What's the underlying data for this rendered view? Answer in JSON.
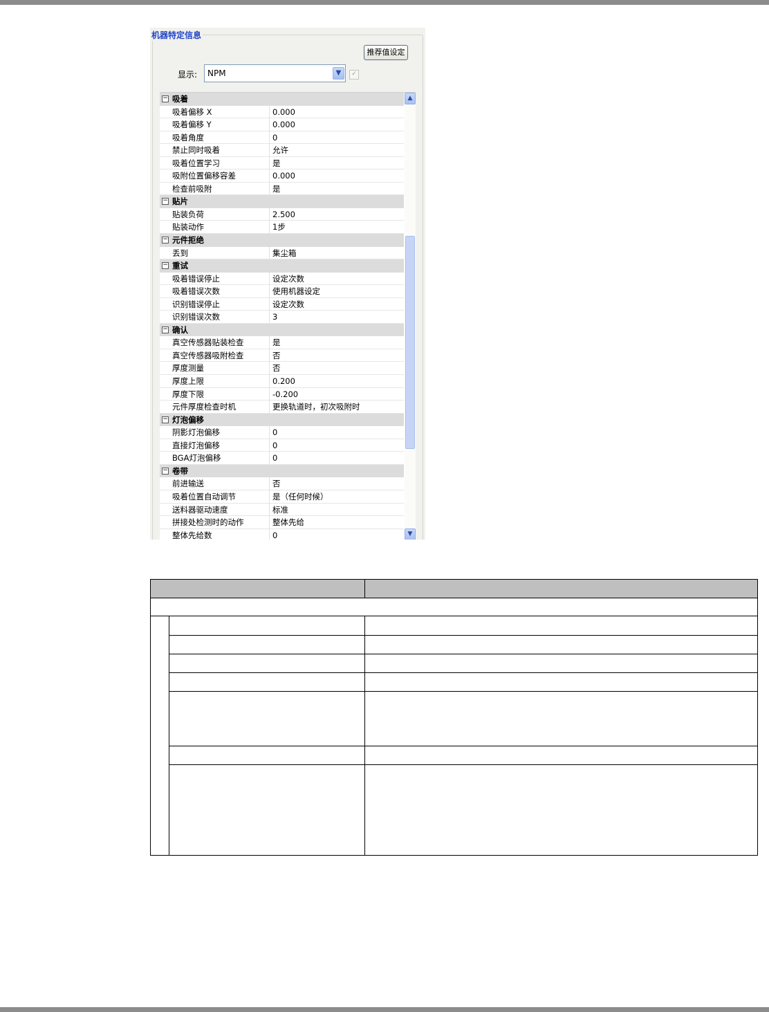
{
  "panel": {
    "group_title": "机器特定信息",
    "recommend_button": "推荐值设定",
    "display_label": "显示:",
    "display_value": "NPM",
    "checkbox_glyph": "✓"
  },
  "grid": {
    "rows": [
      {
        "type": "cat",
        "label": "吸着"
      },
      {
        "type": "prop",
        "name": "吸着偏移 X",
        "value": "0.000"
      },
      {
        "type": "prop",
        "name": "吸着偏移 Y",
        "value": "0.000"
      },
      {
        "type": "prop",
        "name": "吸着角度",
        "value": "0"
      },
      {
        "type": "prop",
        "name": "禁止同时吸着",
        "value": "允许"
      },
      {
        "type": "prop",
        "name": "吸着位置学习",
        "value": "是"
      },
      {
        "type": "prop",
        "name": "吸附位置偏移容差",
        "value": "0.000"
      },
      {
        "type": "prop",
        "name": "检查前吸附",
        "value": "是"
      },
      {
        "type": "cat",
        "label": "贴片"
      },
      {
        "type": "prop",
        "name": "贴装负荷",
        "value": "2.500"
      },
      {
        "type": "prop",
        "name": "贴装动作",
        "value": "1步"
      },
      {
        "type": "cat",
        "label": "元件拒绝"
      },
      {
        "type": "prop",
        "name": "丢到",
        "value": "集尘箱"
      },
      {
        "type": "cat",
        "label": "重试"
      },
      {
        "type": "prop",
        "name": "吸着错误停止",
        "value": "设定次数"
      },
      {
        "type": "prop",
        "name": "吸着错误次数",
        "value": "使用机器设定"
      },
      {
        "type": "prop",
        "name": "识别错误停止",
        "value": "设定次数"
      },
      {
        "type": "prop",
        "name": "识别错误次数",
        "value": "3"
      },
      {
        "type": "cat",
        "label": "确认"
      },
      {
        "type": "prop",
        "name": "真空传感器贴装检查",
        "value": "是"
      },
      {
        "type": "prop",
        "name": "真空传感器吸附检查",
        "value": "否"
      },
      {
        "type": "prop",
        "name": "厚度测量",
        "value": "否"
      },
      {
        "type": "prop",
        "name": "厚度上限",
        "value": "0.200"
      },
      {
        "type": "prop",
        "name": "厚度下限",
        "value": "-0.200"
      },
      {
        "type": "prop",
        "name": "元件厚度检查时机",
        "value": "更换轨道时，初次吸附时"
      },
      {
        "type": "cat",
        "label": "灯泡偏移"
      },
      {
        "type": "prop",
        "name": "阴影灯泡偏移",
        "value": "0"
      },
      {
        "type": "prop",
        "name": "直接灯泡偏移",
        "value": "0"
      },
      {
        "type": "prop",
        "name": "BGA灯泡偏移",
        "value": "0"
      },
      {
        "type": "cat",
        "label": "卷带"
      },
      {
        "type": "prop",
        "name": "前进输送",
        "value": "否"
      },
      {
        "type": "prop",
        "name": "吸着位置自动调节",
        "value": "是（任何时候）"
      },
      {
        "type": "prop",
        "name": "送料器驱动速度",
        "value": "标准"
      },
      {
        "type": "prop",
        "name": "拼接处检测时的动作",
        "value": "整体先给"
      },
      {
        "type": "prop",
        "name": "整体先给数",
        "value": "0"
      }
    ],
    "collapse_glyph": "−",
    "scroll_up_glyph": "▲",
    "scroll_down_glyph": "▼"
  }
}
